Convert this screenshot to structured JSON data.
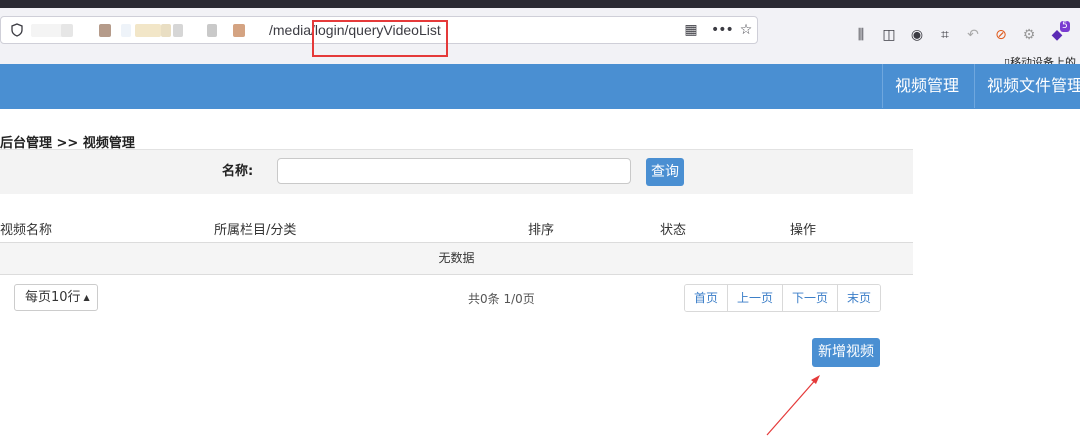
{
  "browser": {
    "url_visible": "/media/login/queryVideoList",
    "toolbar_icons": [
      "library-icon",
      "sidebar-icon",
      "account-icon",
      "crop-icon",
      "back-icon",
      "blocked-icon",
      "extension-icon",
      "notification-icon"
    ],
    "notification_badge": "5",
    "bookmark_label": "移动设备上的"
  },
  "header": {
    "nav": [
      {
        "label": "视频管理"
      },
      {
        "label": "视频文件管理"
      }
    ],
    "accent_color": "#4a8fd2"
  },
  "breadcrumb": "后台管理 >> 视频管理",
  "search": {
    "label": "名称:",
    "value": "",
    "button_label": "查询"
  },
  "table": {
    "columns": [
      "视频名称",
      "所属栏目/分类",
      "排序",
      "状态",
      "操作"
    ],
    "empty_text": "无数据"
  },
  "footer": {
    "page_size": "每页10行",
    "page_info": "共0条 1/0页",
    "pages": [
      "首页",
      "上一页",
      "下一页",
      "末页"
    ]
  },
  "add_button": "新增视频"
}
